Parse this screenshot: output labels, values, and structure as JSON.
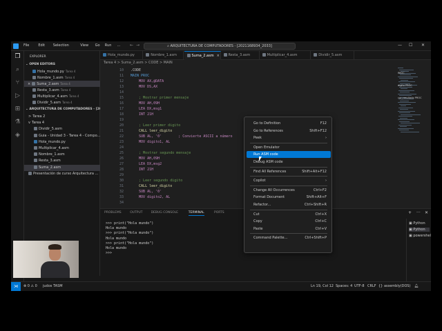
{
  "window": {
    "menu": [
      "File",
      "Edit",
      "Selection",
      "View",
      "Go",
      "Run",
      "..."
    ],
    "command_center": "ARQUITECTURA DE COMPUTADORES - [2021168934_2033]",
    "controls": {
      "minimize": "—",
      "maximize": "☐",
      "close": "✕"
    }
  },
  "sidebar": {
    "title": "EXPLORER",
    "open_editors_label": "OPEN EDITORS",
    "open_editors": [
      {
        "name": "Hola_mundo.py",
        "tag": "Tarea 4",
        "color": "#3572a5"
      },
      {
        "name": "Nombre_1.asm",
        "tag": "Tarea 4",
        "color": "#6e7681"
      },
      {
        "name": "Suma_2.asm",
        "tag": "Tarea 4",
        "color": "#6e7681",
        "close": "×",
        "selected": true
      },
      {
        "name": "Resta_3.asm",
        "tag": "Tarea 4",
        "color": "#6e7681"
      },
      {
        "name": "Multiplicar_4.asm",
        "tag": "Tarea 4",
        "color": "#6e7681"
      },
      {
        "name": "Dividir_5.asm",
        "tag": "Tarea 4",
        "color": "#6e7681"
      }
    ],
    "folder_label": "ARQUITECTURA DE COMPUTADORES - [20...",
    "tree": [
      {
        "name": "Tarea 2",
        "icon": ">",
        "indent": 0
      },
      {
        "name": "Tarea 4",
        "icon": "v",
        "indent": 0
      },
      {
        "name": "Dividir_5.asm",
        "icon": "",
        "indent": 1
      },
      {
        "name": "Guia - Unidad 3 - Tarea 4 - Compo...",
        "icon": "",
        "indent": 1
      },
      {
        "name": "Hola_mundo.py",
        "icon": "",
        "indent": 1
      },
      {
        "name": "Multiplicar_4.asm",
        "icon": "",
        "indent": 1
      },
      {
        "name": "Nombre_1.asm",
        "icon": "",
        "indent": 1
      },
      {
        "name": "Resta_3.asm",
        "icon": "",
        "indent": 1
      },
      {
        "name": "Suma_2.asm",
        "icon": "",
        "indent": 1,
        "selected": true
      },
      {
        "name": "Presentación de curso Arquitectura ...",
        "icon": "",
        "indent": 0
      }
    ],
    "timeline_label": "TIMELINE"
  },
  "tabs": [
    {
      "label": "Hola_mundo.py",
      "active": false
    },
    {
      "label": "Nombre_1.asm",
      "active": false
    },
    {
      "label": "Suma_2.asm",
      "active": true
    },
    {
      "label": "Resta_3.asm",
      "active": false
    },
    {
      "label": "Multiplicar_4.asm",
      "active": false
    },
    {
      "label": "Dividir_5.asm",
      "active": false
    }
  ],
  "breadcrumb": "Tarea 4 > Suma_2.asm > CODE > MAIN",
  "editor": {
    "lines": [
      {
        "n": "10",
        "text": ".CODE",
        "color": "#cccccc"
      },
      {
        "n": "11",
        "text": "MAIN PROC",
        "color": "#569cd6"
      },
      {
        "n": "12",
        "text": "    MOV AX,@DATA",
        "color": "#c586c0"
      },
      {
        "n": "13",
        "text": "    MOV DS,AX",
        "color": "#c586c0"
      },
      {
        "n": "14",
        "text": "",
        "color": "#cccccc"
      },
      {
        "n": "15",
        "text": "    ; Mostrar primer mensaje",
        "color": "#6a9955"
      },
      {
        "n": "16",
        "text": "    MOV AH,09H",
        "color": "#c586c0"
      },
      {
        "n": "17",
        "text": "    LEA DX,msg1",
        "color": "#c586c0"
      },
      {
        "n": "18",
        "text": "    INT 21H",
        "color": "#c586c0"
      },
      {
        "n": "19",
        "text": "",
        "color": "#cccccc"
      },
      {
        "n": "20",
        "text": "    ; Leer primer digito",
        "color": "#6a9955"
      },
      {
        "n": "21",
        "text": "    CALL leer_digito",
        "color": "#dcdcaa"
      },
      {
        "n": "22",
        "text": "    SUB AL, '0'        ; Convierte ASCII a número",
        "color": "#c586c0"
      },
      {
        "n": "23",
        "text": "    MOV digito1, AL",
        "color": "#c586c0"
      },
      {
        "n": "24",
        "text": "",
        "color": "#cccccc"
      },
      {
        "n": "25",
        "text": "    ; Mostrar segundo mensaje",
        "color": "#6a9955"
      },
      {
        "n": "26",
        "text": "    MOV AH,09H",
        "color": "#c586c0"
      },
      {
        "n": "27",
        "text": "    LEA DX,msg2",
        "color": "#c586c0"
      },
      {
        "n": "28",
        "text": "    INT 21H",
        "color": "#c586c0"
      },
      {
        "n": "29",
        "text": "",
        "color": "#cccccc"
      },
      {
        "n": "30",
        "text": "    ; Leer segundo digito",
        "color": "#6a9955"
      },
      {
        "n": "31",
        "text": "    CALL leer_digito",
        "color": "#dcdcaa"
      },
      {
        "n": "32",
        "text": "    SUB AL, '0'",
        "color": "#c586c0"
      },
      {
        "n": "33",
        "text": "    MOV digito2, AL",
        "color": "#c586c0"
      },
      {
        "n": "34",
        "text": "",
        "color": "#cccccc"
      }
    ],
    "minimap_labels": [
      "PROC",
      "digito PROC",
      "car_resultado PROC"
    ]
  },
  "panel": {
    "tabs": [
      "PROBLEMS",
      "OUTPUT",
      "DEBUG CONSOLE",
      "TERMINAL",
      "PORTS"
    ],
    "active_tab": "TERMINAL",
    "terminal_lines": [
      ">>> print(\"Hola mundo\")",
      "Hola mundo",
      ">>> print(\"Hola mundo\")",
      "Hola mundo",
      ">>> print(\"Hola mundo\")",
      "Hola mundo",
      ">>>"
    ],
    "terminals": [
      "Python",
      "Python",
      "powershell"
    ],
    "toolbar": {
      "add": "+",
      "more": "···",
      "close": "✕"
    }
  },
  "context_menu": {
    "items": [
      {
        "label": "Go to Definition",
        "key": "F12"
      },
      {
        "label": "Go to References",
        "key": "Shift+F12"
      },
      {
        "label": "Peek",
        "key": "›"
      },
      {
        "sep": true
      },
      {
        "label": "Open Emulator",
        "key": ""
      },
      {
        "label": "Run ASM code",
        "key": "",
        "highlight": true
      },
      {
        "label": "Debug ASM code",
        "key": ""
      },
      {
        "sep": true
      },
      {
        "label": "Find All References",
        "key": "Shift+Alt+F12"
      },
      {
        "sep": true
      },
      {
        "label": "Copilot",
        "key": "›"
      },
      {
        "sep": true
      },
      {
        "label": "Change All Occurrences",
        "key": "Ctrl+F2"
      },
      {
        "label": "Format Document",
        "key": "Shift+Alt+F"
      },
      {
        "label": "Refactor...",
        "key": "Ctrl+Shift+R"
      },
      {
        "sep": true
      },
      {
        "label": "Cut",
        "key": "Ctrl+X"
      },
      {
        "label": "Copy",
        "key": "Ctrl+C"
      },
      {
        "label": "Paste",
        "key": "Ctrl+V"
      },
      {
        "sep": true
      },
      {
        "label": "Command Palette...",
        "key": "Ctrl+Shift+P"
      }
    ]
  },
  "statusbar": {
    "remote": "⋊",
    "problems": "⊗ 0  ⚠ 0",
    "extension": "judos TASM",
    "position": "Ln 19, Col 12",
    "spaces": "Spaces: 4",
    "encoding": "UTF-8",
    "eol": "CRLF",
    "language": "{} assembly(DOS)"
  },
  "colors": {
    "accent": "#0078d4",
    "bg": "#1f1f1f",
    "sidebar": "#181818"
  }
}
